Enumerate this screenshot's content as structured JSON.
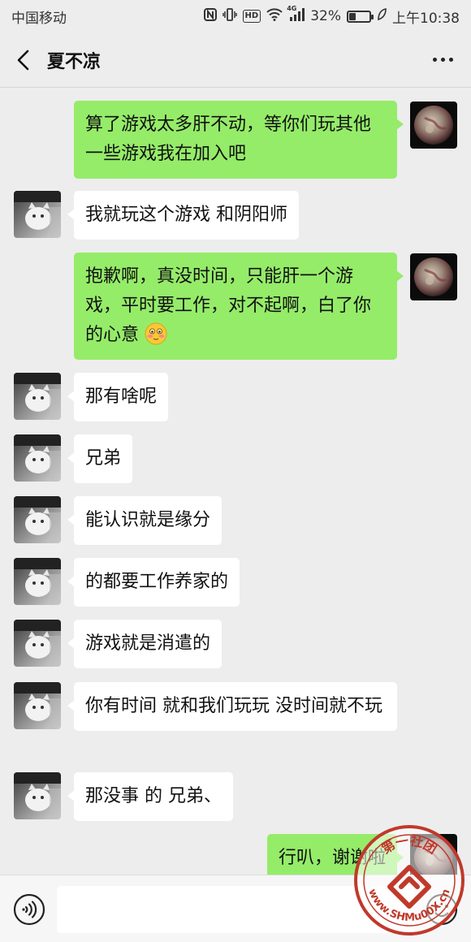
{
  "status_bar": {
    "carrier": "中国移动",
    "network": "4G",
    "battery": "32%",
    "battery_level": 0.32,
    "time": "上午10:38",
    "icons": [
      "nfc-icon",
      "vibrate-icon",
      "hd-icon",
      "wifi-icon",
      "signal-icon",
      "battery-icon",
      "leaf-icon"
    ]
  },
  "header": {
    "title": "夏不凉",
    "back_icon": "back-arrow-icon",
    "more_icon": "more-dots-icon"
  },
  "messages": [
    {
      "side": "self",
      "text": "算了游戏太多肝不动，等你们玩其他一些游戏我在加入吧"
    },
    {
      "side": "other",
      "text": "我就玩这个游戏 和阴阳师"
    },
    {
      "side": "self",
      "text": "抱歉啊，真没时间，只能肝一个游戏，平时要工作，对不起啊，白了你的心意",
      "emoji": "blushing-face-emoji"
    },
    {
      "side": "other",
      "text": "那有啥呢"
    },
    {
      "side": "other",
      "text": "兄弟"
    },
    {
      "side": "other",
      "text": "能认识就是缘分"
    },
    {
      "side": "other",
      "text": "的都要工作养家的"
    },
    {
      "side": "other",
      "text": "游戏就是消遣的"
    },
    {
      "side": "other",
      "text": "你有时间 就和我们玩玩  没时间就不玩"
    },
    {
      "side": "other",
      "text": "那没事 的 兄弟、"
    },
    {
      "side": "self",
      "text": "行叭，谢谢啦"
    }
  ],
  "input_bar": {
    "voice_icon": "voice-icon",
    "emoji_icon": "emoji-icon",
    "placeholder": ""
  },
  "watermark": {
    "text": "www.SHMu00X.cn",
    "top_text": "第一社团"
  },
  "colors": {
    "background": "#ededed",
    "self_bubble": "#95ec69",
    "other_bubble": "#ffffff",
    "watermark": "#c0392b"
  }
}
